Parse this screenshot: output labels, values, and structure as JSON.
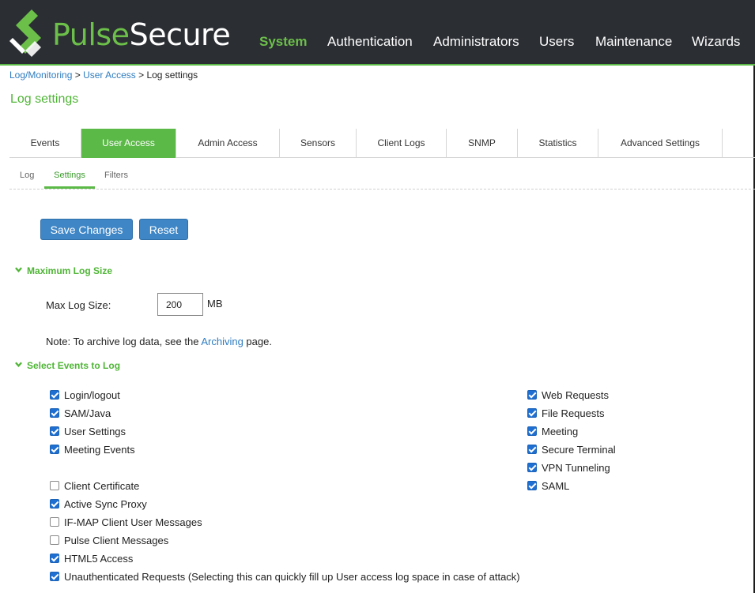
{
  "header": {
    "logo_text_a": "Pulse",
    "logo_text_b": "Secure",
    "nav": [
      "System",
      "Authentication",
      "Administrators",
      "Users",
      "Maintenance",
      "Wizards"
    ],
    "active_nav": "System"
  },
  "breadcrumb": {
    "item1": "Log/Monitoring",
    "sep1": " > ",
    "item2": "User Access",
    "sep2": " > ",
    "current": "Log settings"
  },
  "page_title": "Log settings",
  "tabs": [
    "Events",
    "User Access",
    "Admin Access",
    "Sensors",
    "Client Logs",
    "SNMP",
    "Statistics",
    "Advanced Settings"
  ],
  "active_tab": "User Access",
  "subtabs": [
    "Log",
    "Settings",
    "Filters"
  ],
  "active_subtab": "Settings",
  "buttons": {
    "save": "Save Changes",
    "reset": "Reset"
  },
  "max_log_size": {
    "heading": "Maximum Log Size",
    "label": "Max Log Size:",
    "value": "200",
    "unit": "MB",
    "note_prefix": "Note: To archive log data, see the ",
    "note_link": "Archiving",
    "note_suffix": " page."
  },
  "events": {
    "heading": "Select Events to Log",
    "left": [
      {
        "label": "Login/logout",
        "checked": true
      },
      {
        "label": "SAM/Java",
        "checked": true
      },
      {
        "label": "User Settings",
        "checked": true
      },
      {
        "label": "Meeting Events",
        "checked": true
      },
      {
        "label": "Client Certificate",
        "checked": false
      },
      {
        "label": "Active Sync Proxy",
        "checked": true
      },
      {
        "label": "IF-MAP Client User Messages",
        "checked": false
      },
      {
        "label": "Pulse Client Messages",
        "checked": false
      },
      {
        "label": "HTML5 Access",
        "checked": true
      },
      {
        "label": "Unauthenticated Requests (Selecting this can quickly fill up User access log space in case of attack)",
        "checked": true
      }
    ],
    "right": [
      {
        "label": "Web Requests",
        "checked": true
      },
      {
        "label": "File Requests",
        "checked": true
      },
      {
        "label": "Meeting",
        "checked": true
      },
      {
        "label": "Secure Terminal",
        "checked": true
      },
      {
        "label": "VPN Tunneling",
        "checked": true
      },
      {
        "label": "SAML",
        "checked": true
      }
    ]
  },
  "colors": {
    "brand_green": "#5bb947",
    "header_bg": "#2b2e33",
    "link_blue": "#2f7cc0",
    "button_blue": "#3e86c6"
  }
}
